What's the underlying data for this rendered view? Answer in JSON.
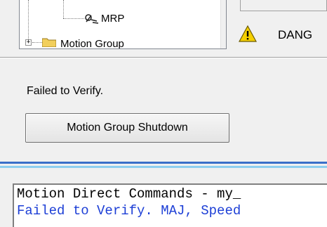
{
  "tree": {
    "items": [
      {
        "label": "MRP",
        "icon": "mrp-icon"
      },
      {
        "label": "Motion Group",
        "icon": "folder-icon",
        "expander": "+"
      }
    ]
  },
  "status": {
    "danger_label": "DANG",
    "message": "Failed to Verify."
  },
  "actions": {
    "shutdown_label": "Motion Group Shutdown"
  },
  "log": {
    "lines": [
      {
        "text": "Motion Direct Commands - my_",
        "color": "#000000"
      },
      {
        "text": "Failed to Verify. MAJ, Speed",
        "color": "#1d3fd6"
      }
    ]
  },
  "colors": {
    "warning": "#f5d000",
    "log_error": "#1d3fd6",
    "separator_dark": "#3a6fc8",
    "separator_light": "#8ecff0"
  }
}
